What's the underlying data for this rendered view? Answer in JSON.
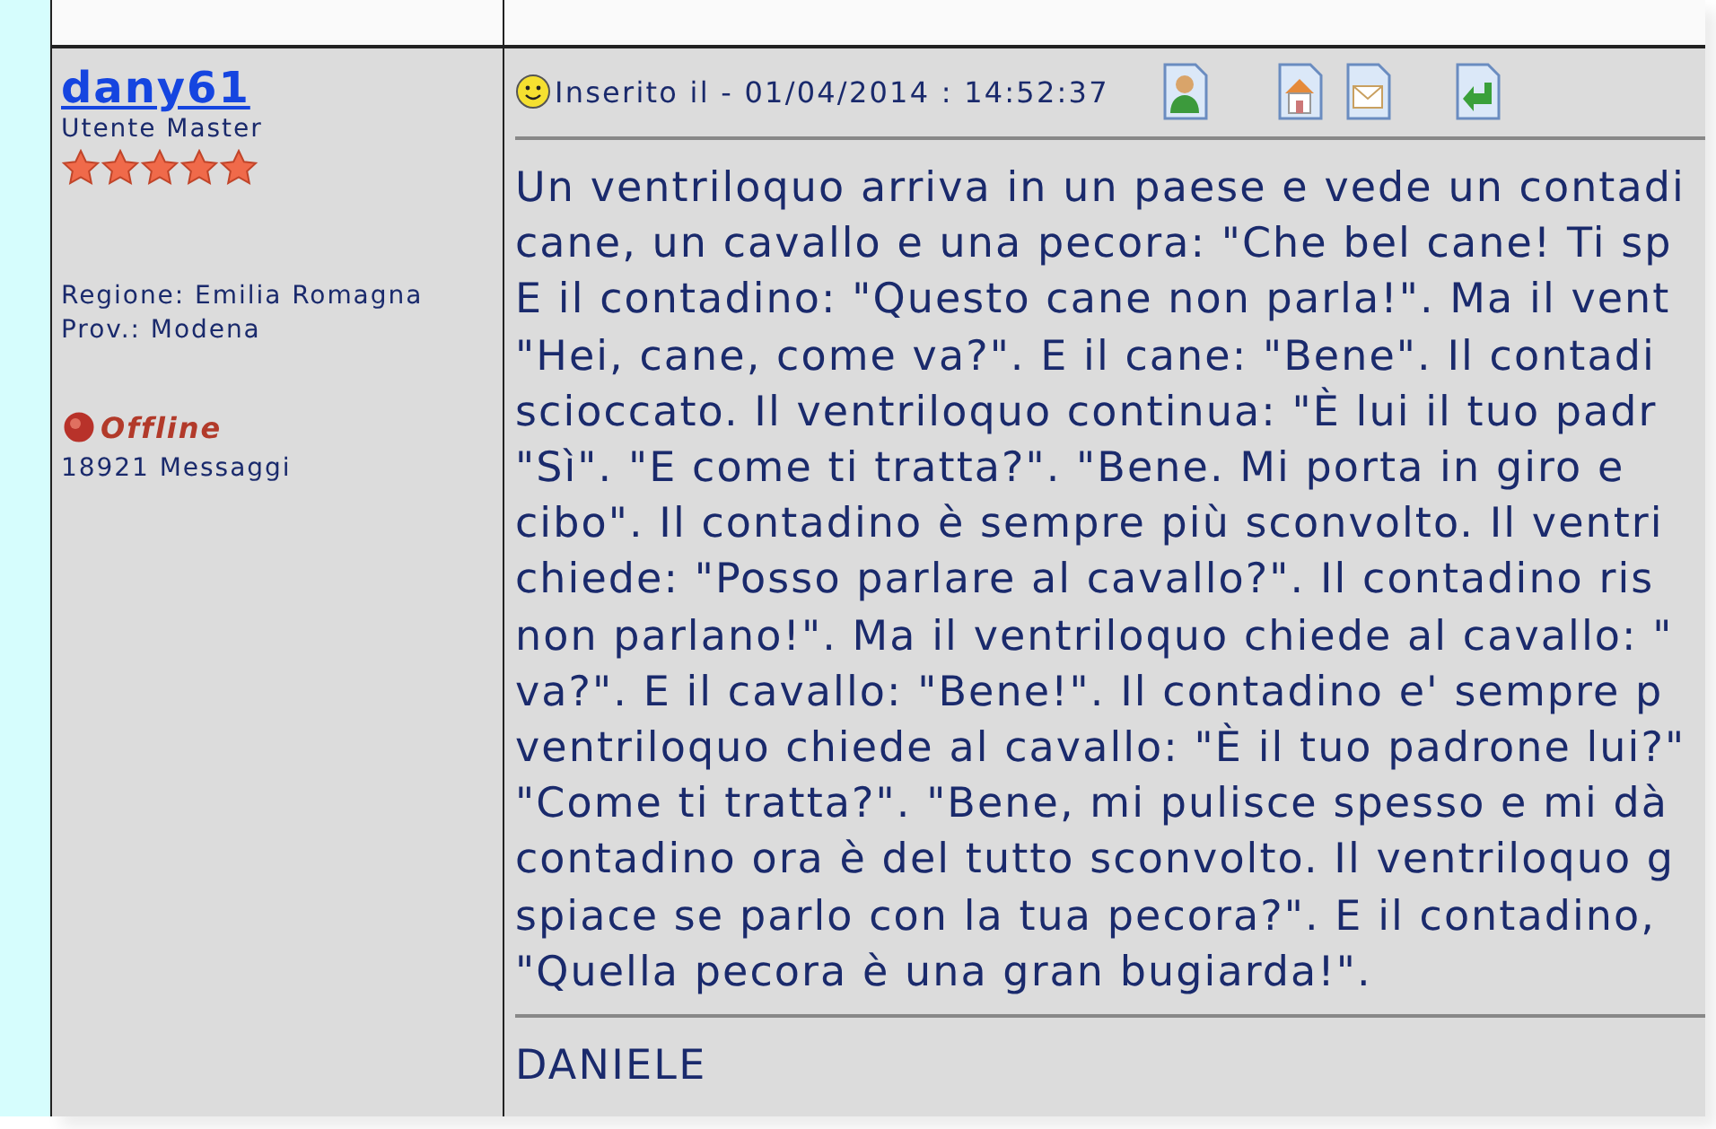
{
  "author": {
    "username": "dany61",
    "rank": "Utente Master",
    "stars": 5,
    "region": "Regione: Emilia Romagna",
    "province": "Prov.: Modena",
    "status": "Offline",
    "messages": "18921 Messaggi"
  },
  "post": {
    "posted": "Inserito il - 01/04/2014 : 14:52:37",
    "body": [
      "Un ventriloquo arriva in un paese e vede un contadi",
      "cane, un cavallo e una pecora: \"Che bel cane! Ti sp",
      "E il contadino: \"Questo cane non parla!\". Ma il vent",
      "\"Hei, cane, come va?\". E il cane: \"Bene\". Il contadi",
      "scioccato. Il ventriloquo continua: \"È lui il tuo padr",
      "\"Sì\". \"E come ti tratta?\". \"Bene. Mi porta in giro e",
      "cibo\". Il contadino è sempre più sconvolto. Il ventri",
      "chiede: \"Posso parlare al cavallo?\". Il contadino ris",
      "non parlano!\". Ma il ventriloquo chiede al cavallo: \"",
      "va?\". E il cavallo: \"Bene!\". Il contadino e' sempre p",
      "ventriloquo chiede al cavallo: \"È il tuo padrone lui?\"",
      "\"Come ti tratta?\". \"Bene, mi pulisce spesso e mi dà",
      "contadino ora è del tutto sconvolto. Il ventriloquo g",
      "spiace se parlo con la tua pecora?\". E il contadino,",
      "\"Quella pecora è una gran bugiarda!\"."
    ],
    "signature": "DANIELE"
  }
}
